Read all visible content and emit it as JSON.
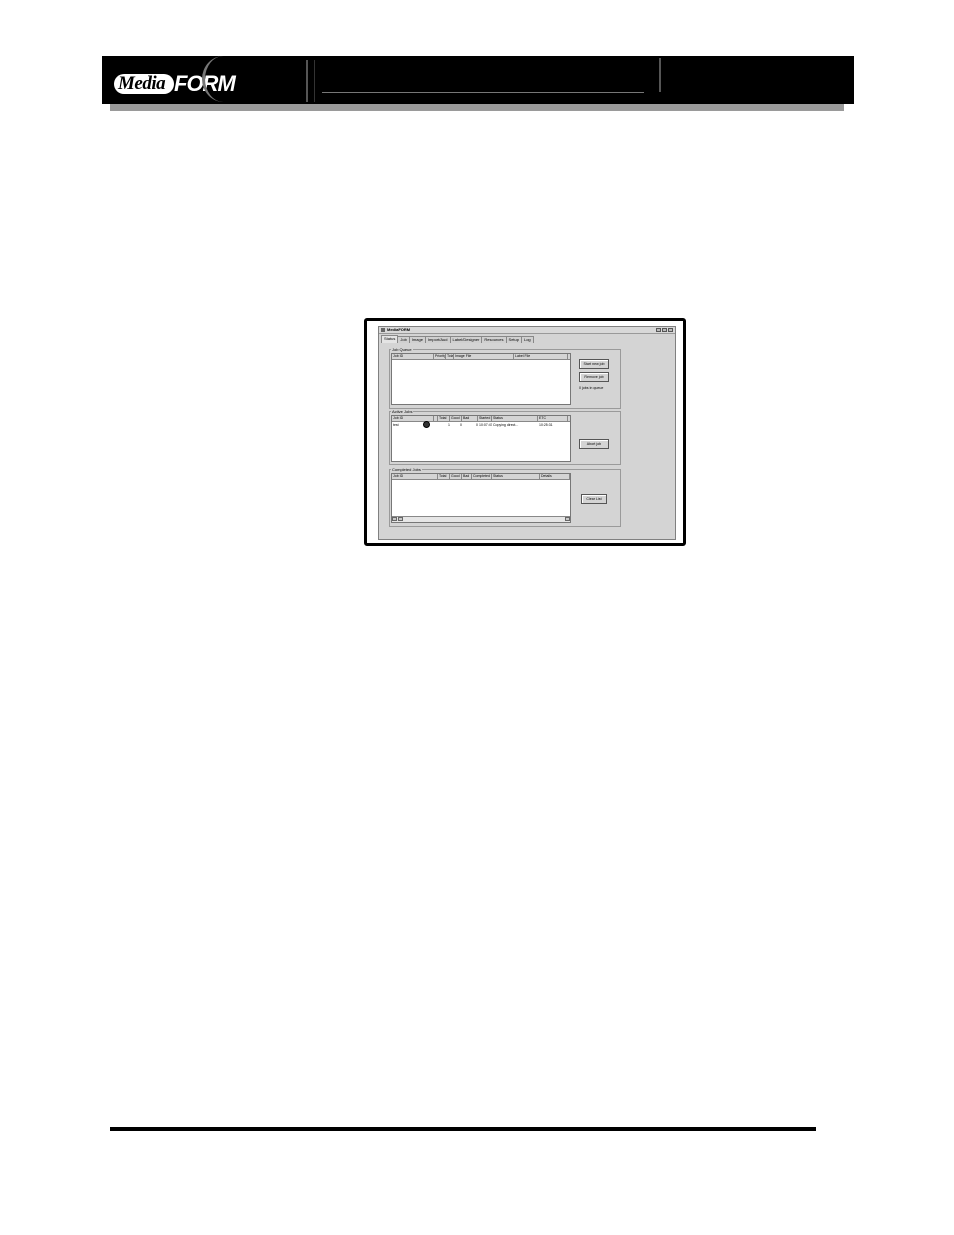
{
  "header": {
    "logo_media": "Media",
    "logo_form": "FORM"
  },
  "window": {
    "title": "MediaFORM",
    "tabs": [
      "Status",
      "Job",
      "Image",
      "Import/Aud",
      "Label/Designer",
      "Resources",
      "Setup",
      "Log"
    ],
    "job_queue": {
      "label": "Job Queue",
      "columns": [
        "Job ID",
        "Priority",
        "Total",
        "Image File",
        "Label File"
      ],
      "buttons": {
        "start_new_job": "Start new job",
        "remove_job": "Remove job"
      },
      "jobs_in_queue": "0 jobs in queue"
    },
    "active_jobs": {
      "label": "Active Jobs",
      "columns": [
        "Job ID",
        "",
        "Total",
        "Good",
        "Bad",
        "Started",
        "Status",
        "ETC"
      ],
      "row": {
        "job_id": "test",
        "total": "1",
        "good": "0",
        "bad": "0",
        "started": "10:07:47",
        "status": "Copying direct...",
        "etc": "10:25:31"
      },
      "buttons": {
        "abort_job": "Abort job"
      }
    },
    "completed_jobs": {
      "label": "Completed Jobs",
      "columns": [
        "Job ID",
        "Total",
        "Good",
        "Bad",
        "Completed",
        "Status",
        "Details"
      ],
      "buttons": {
        "clear_list": "Clear List"
      }
    }
  }
}
